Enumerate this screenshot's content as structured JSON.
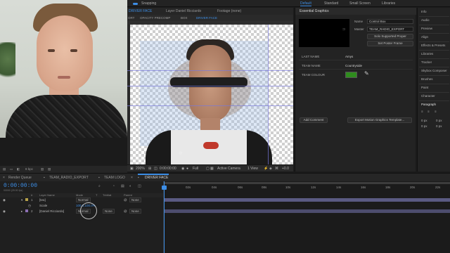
{
  "topbar": {
    "snapping": "Snapping",
    "workspaces": [
      "Default",
      "Standard",
      "Small Screen",
      "Libraries"
    ],
    "active": "Default"
  },
  "comp_tabs": {
    "composition": "DRIVER FACE",
    "layer": "Layer Daniel Ricciardo",
    "footage": "Footage (none)"
  },
  "breadcrumbs": [
    "ORT",
    "OPACITY PRECOMP",
    "BOX",
    "DRIVER FACE"
  ],
  "viewer_footer": {
    "zoom": "200%",
    "timecode": "0:00:00:00",
    "quality": "Full",
    "camera": "Active Camera",
    "views": "1 View",
    "offset": "+0.0"
  },
  "project_footer": {
    "depth": "8 bpc"
  },
  "essential_graphics": {
    "title": "Essential Graphics",
    "name_label": "Name",
    "name_value": "Control Box",
    "master_label": "Master",
    "master_value": "TEAM_RADIO_EXPORT",
    "solo_button": "Solo Supported Proper",
    "poster_button": "Set Poster Frame",
    "properties": [
      {
        "label": "LAST NAME",
        "value": "Amys"
      },
      {
        "label": "TEAM NAME",
        "value": "Countryside"
      },
      {
        "label": "TEAM COLOUR",
        "value": ""
      }
    ],
    "team_colour": "#2f8c1e",
    "add_comment": "Add Comment",
    "export_button": "Export Motion Graphics Template..."
  },
  "right_panels": [
    "Info",
    "Audio",
    "Preview",
    "Align",
    "Effects & Presets",
    "Libraries",
    "Tracker",
    "Skybox Composer",
    "Brushes",
    "Paint",
    "Character",
    "Paragraph"
  ],
  "paragraph_values": [
    "0 px",
    "0 px",
    "0 px",
    "0 px"
  ],
  "timeline_tabs": [
    "Render Queue",
    "TEAM_RADIO_EXPORT",
    "TEAM LOGO",
    "DRIVER FACE"
  ],
  "timeline_active_tab": "DRIVER FACE",
  "timeline": {
    "timecode": "0:00:00:00",
    "timecode_sub": "00000 (25.00 fps)",
    "columns": [
      "#",
      "Layer Name",
      "Mode",
      "T",
      "TrkMat",
      "Parent"
    ],
    "layers": [
      {
        "num": "1",
        "name": "[tea]",
        "mode": "Normal",
        "trkmat": "",
        "parent": "None",
        "color": "#b7a24a"
      },
      {
        "num": "",
        "name": "Scale",
        "mode": "100.0,100.0%",
        "trkmat": "",
        "parent": "",
        "color": ""
      },
      {
        "num": "2",
        "name": "[Daniel Ricciardo]",
        "mode": "Normal",
        "trkmat": "None",
        "parent": "None",
        "color": "#8b6fb3"
      }
    ],
    "ruler": [
      "0f",
      "02s",
      "04s",
      "06s",
      "08s",
      "10s",
      "12s",
      "14s",
      "16s",
      "18s",
      "20s",
      "22s"
    ]
  },
  "colors": {
    "accent": "#3d8ee6",
    "track_bar": "#5a5a82",
    "track_bar2": "#4d4d6e"
  }
}
